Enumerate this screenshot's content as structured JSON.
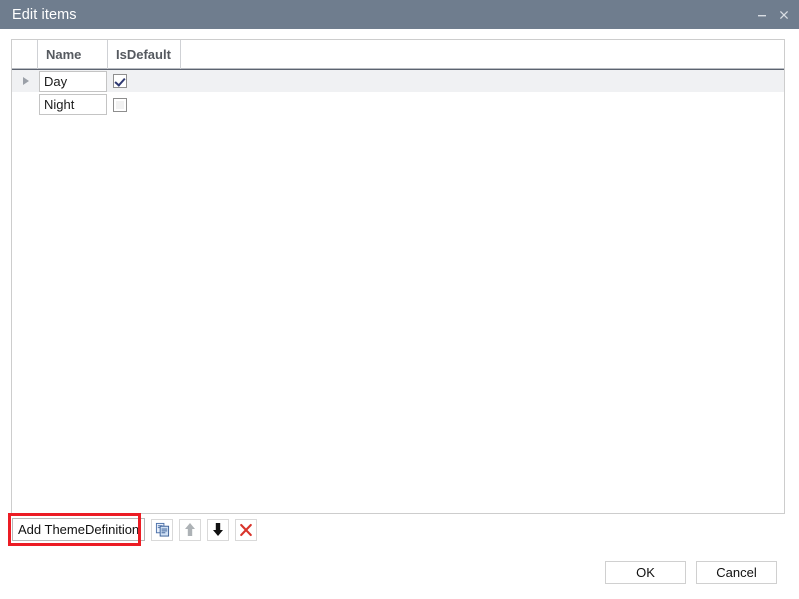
{
  "window": {
    "title": "Edit items",
    "titlebar_color": "#6f7d8e",
    "controls": [
      {
        "name": "minimize-button",
        "glyph": "minimize"
      },
      {
        "name": "close-button",
        "glyph": "close"
      }
    ]
  },
  "grid": {
    "columns": [
      {
        "key": "indicator",
        "label": ""
      },
      {
        "key": "name",
        "label": "Name"
      },
      {
        "key": "isdefault",
        "label": "IsDefault"
      },
      {
        "key": "filler",
        "label": ""
      }
    ],
    "rows": [
      {
        "name": "Day",
        "isdefault": true,
        "selected": true
      },
      {
        "name": "Night",
        "isdefault": false,
        "selected": false
      }
    ]
  },
  "toolbar": {
    "add_label": "Add ThemeDefinition",
    "icons": [
      {
        "name": "copy-icon",
        "label": "Copy",
        "enabled": true
      },
      {
        "name": "arrow-up-icon",
        "label": "Move up",
        "enabled": false
      },
      {
        "name": "arrow-down-icon",
        "label": "Move down",
        "enabled": true
      },
      {
        "name": "delete-x-icon",
        "label": "Delete",
        "enabled": true
      }
    ]
  },
  "annotation": {
    "color": "#ec1c24",
    "target": "Add ThemeDefinition"
  },
  "dialog": {
    "ok_label": "OK",
    "cancel_label": "Cancel"
  }
}
